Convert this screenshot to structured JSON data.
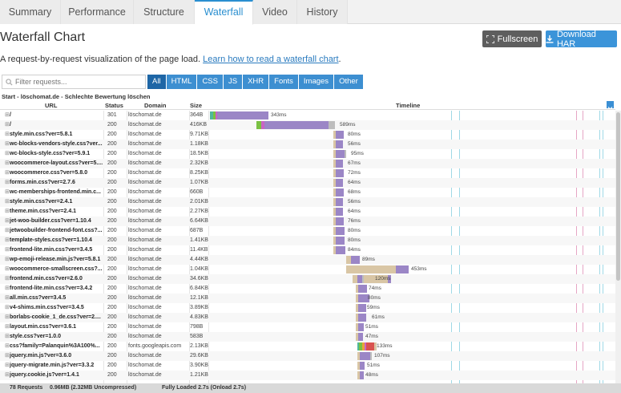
{
  "tabs": [
    {
      "label": "Summary",
      "active": false
    },
    {
      "label": "Performance",
      "active": false
    },
    {
      "label": "Structure",
      "active": false
    },
    {
      "label": "Waterfall",
      "active": true
    },
    {
      "label": "Video",
      "active": false
    },
    {
      "label": "History",
      "active": false
    }
  ],
  "page_title": "Waterfall Chart",
  "buttons": {
    "fullscreen": "Fullscreen",
    "download_har": "Download HAR"
  },
  "description": {
    "text": "A request-by-request visualization of the page load. ",
    "link": "Learn how to read a waterfall chart",
    "suffix": "."
  },
  "search": {
    "placeholder": "Filter requests..."
  },
  "filters": [
    {
      "label": "All",
      "active": true
    },
    {
      "label": "HTML",
      "active": false
    },
    {
      "label": "CSS",
      "active": false
    },
    {
      "label": "JS",
      "active": false
    },
    {
      "label": "XHR",
      "active": false
    },
    {
      "label": "Fonts",
      "active": false
    },
    {
      "label": "Images",
      "active": false
    },
    {
      "label": "Other",
      "active": false
    }
  ],
  "table": {
    "start_label": "Start - löschomat.de - Schlechte Bewertung löschen",
    "headers": {
      "url": "URL",
      "status": "Status",
      "domain": "Domain",
      "size": "Size",
      "timeline": "Timeline"
    }
  },
  "colors": {
    "dns": "#4fb89a",
    "connect": "#e8a33d",
    "ssl": "#c964c4",
    "wait": "#d9c6a5",
    "receive": "#9b86c6",
    "blocked": "#bdbdbd",
    "green": "#7ac142",
    "red": "#d9534f",
    "vline_cyan": "#9fd9e6",
    "vline_pink": "#e6a6c5"
  },
  "requests": [
    {
      "url": "/",
      "status": "301",
      "domain": "löschomat.de",
      "size": "364B",
      "time": "343ms"
    },
    {
      "url": "/",
      "status": "200",
      "domain": "löschomat.de",
      "size": "416KB",
      "time": "589ms"
    },
    {
      "url": "style.min.css?ver=5.8.1",
      "status": "200",
      "domain": "löschomat.de",
      "size": "9.71KB",
      "time": "80ms"
    },
    {
      "url": "wc-blocks-vendors-style.css?ver...",
      "status": "200",
      "domain": "löschomat.de",
      "size": "1.18KB",
      "time": "56ms"
    },
    {
      "url": "wc-blocks-style.css?ver=5.9.1",
      "status": "200",
      "domain": "löschomat.de",
      "size": "18.5KB",
      "time": "95ms"
    },
    {
      "url": "woocommerce-layout.css?ver=5....",
      "status": "200",
      "domain": "löschomat.de",
      "size": "2.32KB",
      "time": "67ms"
    },
    {
      "url": "woocommerce.css?ver=5.8.0",
      "status": "200",
      "domain": "löschomat.de",
      "size": "8.25KB",
      "time": "72ms"
    },
    {
      "url": "forms.min.css?ver=2.7.6",
      "status": "200",
      "domain": "löschomat.de",
      "size": "1.07KB",
      "time": "64ms"
    },
    {
      "url": "wc-memberships-frontend.min.c...",
      "status": "200",
      "domain": "löschomat.de",
      "size": "660B",
      "time": "68ms"
    },
    {
      "url": "style.min.css?ver=2.4.1",
      "status": "200",
      "domain": "löschomat.de",
      "size": "2.01KB",
      "time": "56ms"
    },
    {
      "url": "theme.min.css?ver=2.4.1",
      "status": "200",
      "domain": "löschomat.de",
      "size": "2.27KB",
      "time": "64ms"
    },
    {
      "url": "jet-woo-builder.css?ver=1.10.4",
      "status": "200",
      "domain": "löschomat.de",
      "size": "6.64KB",
      "time": "76ms"
    },
    {
      "url": "jetwoobuilder-frontend-font.css?...",
      "status": "200",
      "domain": "löschomat.de",
      "size": "687B",
      "time": "80ms"
    },
    {
      "url": "template-styles.css?ver=1.10.4",
      "status": "200",
      "domain": "löschomat.de",
      "size": "1.41KB",
      "time": "80ms"
    },
    {
      "url": "frontend-lite.min.css?ver=3.4.5",
      "status": "200",
      "domain": "löschomat.de",
      "size": "11.4KB",
      "time": "84ms"
    },
    {
      "url": "wp-emoji-release.min.js?ver=5.8.1",
      "status": "200",
      "domain": "löschomat.de",
      "size": "4.44KB",
      "time": "89ms"
    },
    {
      "url": "woocommerce-smallscreen.css?...",
      "status": "200",
      "domain": "löschomat.de",
      "size": "1.04KB",
      "time": "453ms"
    },
    {
      "url": "frontend.min.css?ver=2.6.0",
      "status": "200",
      "domain": "löschomat.de",
      "size": "34.6KB",
      "time": "120ms"
    },
    {
      "url": "frontend-lite.min.css?ver=3.4.2",
      "status": "200",
      "domain": "löschomat.de",
      "size": "6.84KB",
      "time": "74ms"
    },
    {
      "url": "all.min.css?ver=3.4.5",
      "status": "200",
      "domain": "löschomat.de",
      "size": "12.1KB",
      "time": "80ms"
    },
    {
      "url": "v4-shims.min.css?ver=3.4.5",
      "status": "200",
      "domain": "löschomat.de",
      "size": "3.89KB",
      "time": "59ms"
    },
    {
      "url": "borlabs-cookie_1_de.css?ver=2....",
      "status": "200",
      "domain": "löschomat.de",
      "size": "4.83KB",
      "time": "61ms"
    },
    {
      "url": "layout.min.css?ver=3.6.1",
      "status": "200",
      "domain": "löschomat.de",
      "size": "798B",
      "time": "51ms"
    },
    {
      "url": "style.css?ver=1.0.0",
      "status": "200",
      "domain": "löschomat.de",
      "size": "583B",
      "time": "47ms"
    },
    {
      "url": "css?family=Palanquin%3A100%...",
      "status": "200",
      "domain": "fonts.googleapis.com",
      "size": "2.13KB",
      "time": "133ms"
    },
    {
      "url": "jquery.min.js?ver=3.6.0",
      "status": "200",
      "domain": "löschomat.de",
      "size": "29.6KB",
      "time": "107ms"
    },
    {
      "url": "jquery-migrate.min.js?ver=3.3.2",
      "status": "200",
      "domain": "löschomat.de",
      "size": "3.90KB",
      "time": "51ms"
    },
    {
      "url": "jquery.cookie.js?ver=1.4.1",
      "status": "200",
      "domain": "löschomat.de",
      "size": "1.21KB",
      "time": "48ms"
    }
  ],
  "footer": {
    "requests": "78 Requests",
    "size": "0.96MB  (2.32MB Uncompressed)",
    "loaded": "Fully Loaded 2.7s  (Onload 2.7s)"
  }
}
